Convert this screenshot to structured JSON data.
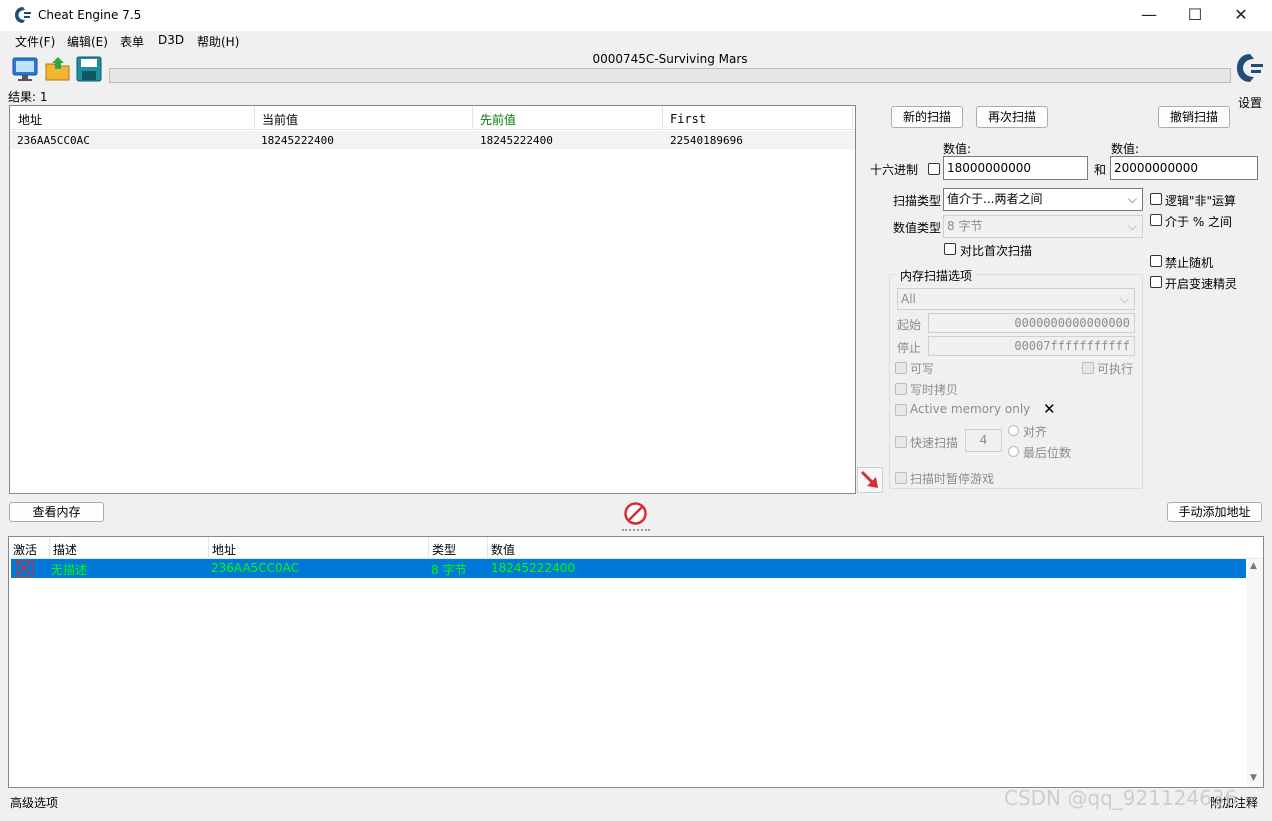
{
  "window": {
    "title": "Cheat Engine 7.5",
    "minimize": "—",
    "maximize": "☐",
    "close": "✕"
  },
  "menu": [
    "文件(F)",
    "编辑(E)",
    "表单",
    "D3D",
    "帮助(H)"
  ],
  "process_title": "0000745C-Surviving Mars",
  "settings_label": "设置",
  "results_label": "结果: 1",
  "results_table": {
    "columns": [
      "地址",
      "当前值",
      "先前值",
      "First"
    ],
    "rows": [
      [
        "236AA5CC0AC",
        "18245222400",
        "18245222400",
        "22540189696"
      ]
    ]
  },
  "scan": {
    "new_scan": "新的扫描",
    "next_scan": "再次扫描",
    "undo_scan": "撤销扫描",
    "value_label_1": "数值:",
    "value_label_2": "数值:",
    "hex_label": "十六进制",
    "value1": "18000000000",
    "and_label": "和",
    "value2": "20000000000",
    "scan_type_label": "扫描类型",
    "scan_type_value": "值介于...两者之间",
    "value_type_label": "数值类型",
    "value_type_value": "8 字节",
    "compare_first": "对比首次扫描",
    "logic_not": "逻辑\"非\"运算",
    "between_pct": "介于 % 之间",
    "disable_random": "禁止随机",
    "speedhack": "开启变速精灵"
  },
  "memory_options": {
    "group_label": "内存扫描选项",
    "region": "All",
    "start_label": "起始",
    "start_value": "0000000000000000",
    "stop_label": "停止",
    "stop_value": "00007fffffffffff",
    "writable": "可写",
    "executable": "可执行",
    "copy_on_write": "写时拷贝",
    "active_memory": "Active memory only",
    "fast_scan": "快速扫描",
    "fast_scan_value": "4",
    "align": "对齐",
    "last_digits": "最后位数",
    "pause_game": "扫描时暂停游戏"
  },
  "view_memory": "查看内存",
  "add_address_manually": "手动添加地址",
  "address_table": {
    "columns": [
      "激活",
      "描述",
      "地址",
      "类型",
      "数值"
    ],
    "rows": [
      {
        "desc": "无描述",
        "address": "236AA5CC0AC",
        "type": "8 字节",
        "value": "18245222400"
      }
    ]
  },
  "status_left": "高级选项",
  "status_right": "附加注释",
  "watermark": "CSDN @qq_921124636",
  "colors": {
    "accent": "#0078d7",
    "green_text": "#00ff00",
    "prev_value_header": "#008000",
    "stop_red": "#d32f2f"
  }
}
